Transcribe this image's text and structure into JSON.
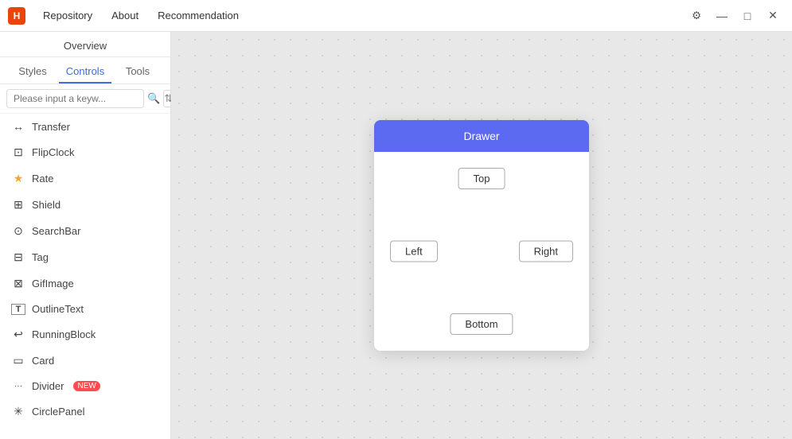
{
  "titlebar": {
    "logo": "H",
    "menu": [
      "Repository",
      "About",
      "Recommendation"
    ],
    "settings_icon": "⚙",
    "minimize": "—",
    "maximize": "□",
    "close": "✕"
  },
  "sidebar": {
    "overview_label": "Overview",
    "tabs": [
      {
        "label": "Styles",
        "active": false
      },
      {
        "label": "Controls",
        "active": true
      },
      {
        "label": "Tools",
        "active": false
      }
    ],
    "search_placeholder": "Please input a keyw...",
    "items": [
      {
        "icon": "↔",
        "label": "Transfer"
      },
      {
        "icon": "⊡",
        "label": "FlipClock"
      },
      {
        "icon": "★",
        "label": "Rate",
        "star": true
      },
      {
        "icon": "⊞",
        "label": "Shield"
      },
      {
        "icon": "⊙",
        "label": "SearchBar"
      },
      {
        "icon": "⊟",
        "label": "Tag"
      },
      {
        "icon": "⊠",
        "label": "GifImage"
      },
      {
        "icon": "T",
        "label": "OutlineText"
      },
      {
        "icon": "↩",
        "label": "RunningBlock"
      },
      {
        "icon": "▭",
        "label": "Card"
      },
      {
        "icon": "···",
        "label": "Divider",
        "badge": "NEW"
      },
      {
        "icon": "✳",
        "label": "CirclePanel"
      }
    ]
  },
  "drawer_demo": {
    "title": "Drawer",
    "top_label": "Top",
    "left_label": "Left",
    "right_label": "Right",
    "bottom_label": "Bottom"
  }
}
